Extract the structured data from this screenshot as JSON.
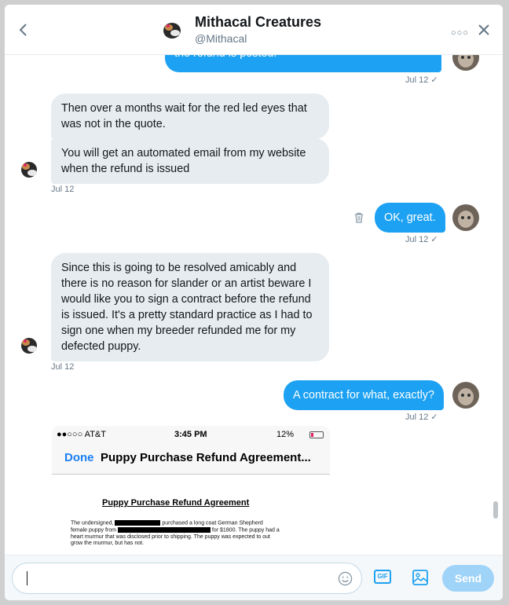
{
  "header": {
    "name": "Mithacal Creatures",
    "handle": "@Mithacal"
  },
  "messages": {
    "m0_partial": "the refund is posted.",
    "m0_time": "Jul 12 ✓",
    "m1": "Then over a months wait for the red led eyes that was not in the quote.",
    "m2": "You will get an automated email from my website when the refund is issued",
    "m2_time": "Jul 12",
    "m3": "OK, great.",
    "m3_time": "Jul 12 ✓",
    "m4": "Since this is going to be resolved amicably and there is no reason for slander or an artist beware I would like you to sign a contract before the refund is issued. It's a pretty standard practice as I had to sign one when my breeder refunded me for my defected puppy.",
    "m4_time": "Jul 12",
    "m5": "A contract for what, exactly?",
    "m5_time": "Jul 12 ✓"
  },
  "screenshot": {
    "carrier": "●●○○○ AT&T",
    "time": "3:45 PM",
    "battery": "12%",
    "done": "Done",
    "title": "Puppy Purchase Refund Agreement...",
    "heading": "Puppy Purchase Refund Agreement",
    "body_1": "The undersigned,",
    "body_2": "purchased a long coat German Shepherd",
    "body_3": "female puppy from",
    "body_4": "for $1800.  The puppy",
    "body_5": "had a heart murmur that was disclosed prior to shipping.  The puppy was expected to out grow the murmur, but has not."
  },
  "composer": {
    "gif": "GIF",
    "send": "Send"
  },
  "colors": {
    "accent": "#1da1f2",
    "incoming_bubble": "#e6ecf0",
    "send_disabled": "#9fd3f8"
  },
  "icons": [
    "back-arrow-icon",
    "more-icon",
    "close-icon",
    "trash-icon",
    "emoji-icon",
    "gif-icon",
    "image-icon"
  ]
}
